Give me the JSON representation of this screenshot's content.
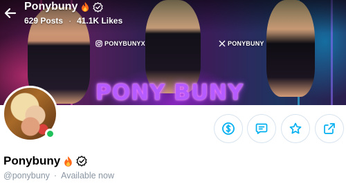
{
  "header": {
    "name": "Ponybuny",
    "posts_count": "629",
    "posts_label": "Posts",
    "likes_count": "41.1K",
    "likes_label": "Likes",
    "stats_separator": "·"
  },
  "banner": {
    "instagram_handle": "PONYBUNYX",
    "x_handle": "PONYBUNY",
    "brand_text": "PONY BUNY"
  },
  "profile": {
    "display_name": "Ponybuny",
    "username": "@ponybuny",
    "separator": "·",
    "status": "Available now"
  },
  "actions": [
    {
      "name": "tip",
      "icon": "dollar-icon"
    },
    {
      "name": "message",
      "icon": "message-icon"
    },
    {
      "name": "favorite",
      "icon": "star-icon"
    },
    {
      "name": "share",
      "icon": "share-icon"
    }
  ],
  "colors": {
    "accent": "#00aff0",
    "online": "#20c05a",
    "muted_text": "#8a96a3",
    "button_border": "#d7e3ef"
  }
}
